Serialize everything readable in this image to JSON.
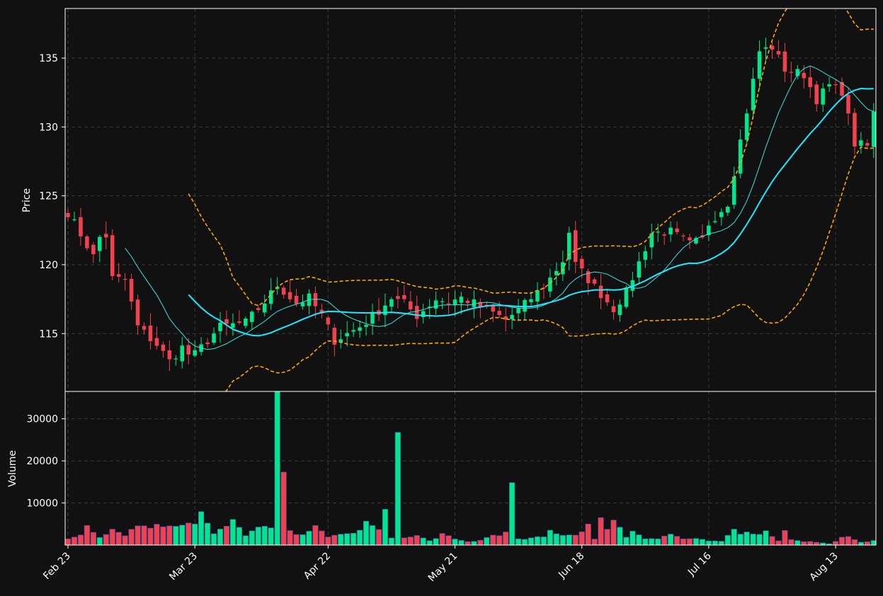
{
  "chart_data": {
    "type": "candlestick",
    "colors": {
      "background": "#111111",
      "up": "#00e68a",
      "down": "#f0414e",
      "sma_fast": "#3fe3e0",
      "sma_slow": "#22e8ff",
      "bollinger": "#ffa500",
      "grid": "#3a3a3a",
      "text": "#ffffff"
    },
    "price_panel": {
      "ylabel": "Price",
      "ylim": [
        110.8,
        138.6
      ],
      "yticks": [
        115,
        120,
        125,
        130,
        135
      ]
    },
    "volume_panel": {
      "ylabel": "Volume",
      "ylim": [
        0,
        36500
      ],
      "yticks": [
        10000,
        20000,
        30000
      ]
    },
    "x_ticks": [
      {
        "index": 0,
        "label": "Feb 23"
      },
      {
        "index": 20,
        "label": "Mar 23"
      },
      {
        "index": 41,
        "label": "Apr 22"
      },
      {
        "index": 61,
        "label": "May 21"
      },
      {
        "index": 81,
        "label": "Jun 18"
      },
      {
        "index": 101,
        "label": "Jul 16"
      },
      {
        "index": 121,
        "label": "Aug 13"
      }
    ],
    "ohlc_knots": [
      [
        0,
        123.8
      ],
      [
        4,
        120.6
      ],
      [
        5,
        122.0
      ],
      [
        6,
        122.1
      ],
      [
        7,
        119.0
      ],
      [
        9,
        118.9
      ],
      [
        11,
        115.5
      ],
      [
        14,
        114.2
      ],
      [
        16,
        113.0
      ],
      [
        18,
        114.0
      ],
      [
        19,
        113.5
      ],
      [
        20,
        113.5
      ],
      [
        24,
        115.5
      ],
      [
        28,
        115.8
      ],
      [
        31,
        117.3
      ],
      [
        33,
        118.5
      ],
      [
        36,
        117.2
      ],
      [
        38,
        117.6
      ],
      [
        40,
        116.3
      ],
      [
        42,
        114.5
      ],
      [
        46,
        115.5
      ],
      [
        48,
        116.2
      ],
      [
        51,
        117.6
      ],
      [
        53,
        117.2
      ],
      [
        55,
        116.3
      ],
      [
        58,
        117.5
      ],
      [
        60,
        117.3
      ],
      [
        62,
        117.6
      ],
      [
        65,
        117.0
      ],
      [
        67,
        116.5
      ],
      [
        69,
        116.0
      ],
      [
        71,
        116.7
      ],
      [
        74,
        118.0
      ],
      [
        76,
        119.0
      ],
      [
        78,
        120.3
      ],
      [
        79,
        122.4
      ],
      [
        80,
        120.0
      ],
      [
        83,
        118.4
      ],
      [
        86,
        116.8
      ],
      [
        88,
        118.0
      ],
      [
        92,
        122.3
      ],
      [
        95,
        122.4
      ],
      [
        98,
        121.5
      ],
      [
        100,
        121.8
      ],
      [
        101,
        123.0
      ],
      [
        104,
        124.5
      ],
      [
        106,
        129.0
      ],
      [
        109,
        135.5
      ],
      [
        111,
        135.8
      ],
      [
        113,
        134.2
      ],
      [
        116,
        133.8
      ],
      [
        118,
        132.0
      ],
      [
        120,
        133.0
      ],
      [
        122,
        132.6
      ],
      [
        124,
        128.8
      ],
      [
        126,
        128.6
      ],
      [
        127,
        131.0
      ]
    ],
    "volume_knots": [
      [
        0,
        1400
      ],
      [
        2,
        2500
      ],
      [
        3,
        4800
      ],
      [
        5,
        2000
      ],
      [
        7,
        3800
      ],
      [
        9,
        2500
      ],
      [
        11,
        4700
      ],
      [
        14,
        4500
      ],
      [
        18,
        5200
      ],
      [
        20,
        5500
      ],
      [
        21,
        7700
      ],
      [
        23,
        2500
      ],
      [
        25,
        4500
      ],
      [
        26,
        5500
      ],
      [
        28,
        2500
      ],
      [
        30,
        4000
      ],
      [
        32,
        4000
      ],
      [
        33,
        34000
      ],
      [
        35,
        3000
      ],
      [
        37,
        2800
      ],
      [
        39,
        4200
      ],
      [
        41,
        1800
      ],
      [
        43,
        2800
      ],
      [
        45,
        2600
      ],
      [
        47,
        5200
      ],
      [
        49,
        3600
      ],
      [
        50,
        7500
      ],
      [
        51,
        1800
      ],
      [
        52,
        31200
      ],
      [
        53,
        1600
      ],
      [
        55,
        2200
      ],
      [
        57,
        1000
      ],
      [
        59,
        2600
      ],
      [
        61,
        1300
      ],
      [
        63,
        800
      ],
      [
        65,
        1100
      ],
      [
        67,
        2400
      ],
      [
        69,
        2800
      ],
      [
        70,
        14200
      ],
      [
        71,
        1300
      ],
      [
        73,
        1600
      ],
      [
        75,
        1900
      ],
      [
        76,
        3400
      ],
      [
        78,
        2500
      ],
      [
        80,
        2400
      ],
      [
        82,
        4900
      ],
      [
        83,
        1300
      ],
      [
        84,
        5900
      ],
      [
        85,
        4300
      ],
      [
        86,
        6300
      ],
      [
        88,
        1900
      ],
      [
        89,
        3500
      ],
      [
        91,
        1700
      ],
      [
        93,
        1500
      ],
      [
        95,
        2600
      ],
      [
        97,
        1500
      ],
      [
        99,
        1400
      ],
      [
        101,
        1000
      ],
      [
        103,
        800
      ],
      [
        104,
        2200
      ],
      [
        105,
        3900
      ],
      [
        106,
        2500
      ],
      [
        107,
        3600
      ],
      [
        108,
        2800
      ],
      [
        110,
        3100
      ],
      [
        111,
        2300
      ],
      [
        112,
        1100
      ],
      [
        113,
        3300
      ],
      [
        114,
        1400
      ],
      [
        116,
        900
      ],
      [
        118,
        700
      ],
      [
        120,
        300
      ],
      [
        122,
        1700
      ],
      [
        123,
        1800
      ],
      [
        125,
        600
      ],
      [
        127,
        1200
      ]
    ]
  }
}
